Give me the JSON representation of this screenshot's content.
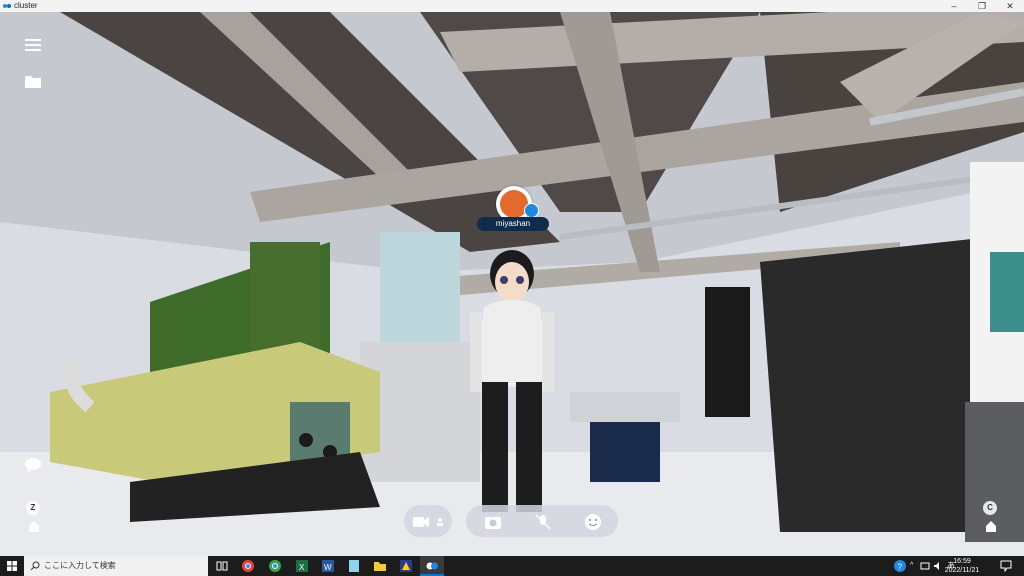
{
  "window": {
    "title": "cluster",
    "minimize_icon": "minimize-icon",
    "maximize_icon": "restore-icon",
    "close_icon": "close-icon"
  },
  "hud": {
    "menu_icon": "hamburger-menu-icon",
    "folder_icon": "folder-icon",
    "chat_icon": "chat-bubble-icon",
    "key_z": "Z",
    "key_c": "C"
  },
  "player": {
    "name": "miyashan"
  },
  "controls": {
    "camera_icon": "video-camera-icon",
    "screenshot_icon": "camera-icon",
    "mic_icon": "mic-muted-icon",
    "emote_icon": "emoji-icon"
  },
  "taskbar": {
    "search_placeholder": "ここに入力して検索",
    "apps": [
      "task-view-icon",
      "chrome-icon",
      "chrome-icon",
      "excel-icon",
      "word-icon",
      "notepad-icon",
      "file-explorer-icon",
      "app-icon",
      "cluster-icon"
    ],
    "time": "16:59",
    "date": "2022/11/21",
    "accent": "#0078d7"
  }
}
